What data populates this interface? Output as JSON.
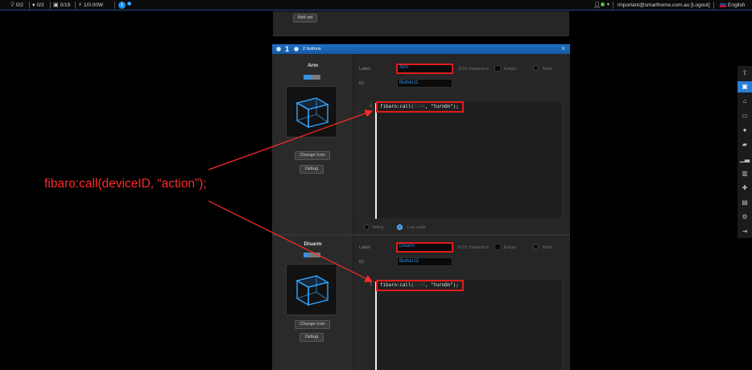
{
  "topbar": {
    "lights": "0/2",
    "lamps": "0/2",
    "devices": "0/19",
    "power": "1/0.00W",
    "info_count": "0",
    "user_count": "1",
    "account": "important@smarthome.com.au [Logout]",
    "language": "English"
  },
  "top_panel": {
    "add_set_label": "Add set"
  },
  "panel": {
    "number": "1",
    "title": "2 buttons",
    "close": "×"
  },
  "buttons": [
    {
      "name": "Arm",
      "label_caption": "Label:",
      "label_value": "Arm",
      "char_count": "3/15 characters",
      "empty_label": "Empty",
      "main_label": "Main",
      "id_caption": "ID:",
      "id_value": "Button11",
      "change_icon": "Change Icon",
      "debug": "Debug",
      "line_no": "1",
      "code_fn": "fibaro:call(",
      "code_id": "2294",
      "code_rest": ", \"turnOn\");",
      "string_label": "String",
      "lua_label": "Lua code"
    },
    {
      "name": "Disarm",
      "label_caption": "Label:",
      "label_value": "Disarm",
      "char_count": "6/15 characters",
      "empty_label": "Empty",
      "main_label": "Main",
      "id_caption": "ID:",
      "id_value": "Button12",
      "change_icon": "Change Icon",
      "debug": "Debug",
      "line_no": "1",
      "code_fn": "fibaro:call(",
      "code_id": "2260",
      "code_rest": ", \"turnOn\");"
    }
  ],
  "annotation": "fibaro:call(deviceID, “action”);",
  "colors": {
    "accent": "#1f6fc4",
    "highlight": "#e11b1b",
    "annotation": "#ff2a2a"
  },
  "sidebar_icons": [
    "arrow-up-icon",
    "save-icon",
    "home-icon",
    "monitor-icon",
    "light-icon",
    "blind-icon",
    "chart-icon",
    "building-icon",
    "plug-icon",
    "device-icon",
    "gear-icon",
    "logout-icon"
  ]
}
